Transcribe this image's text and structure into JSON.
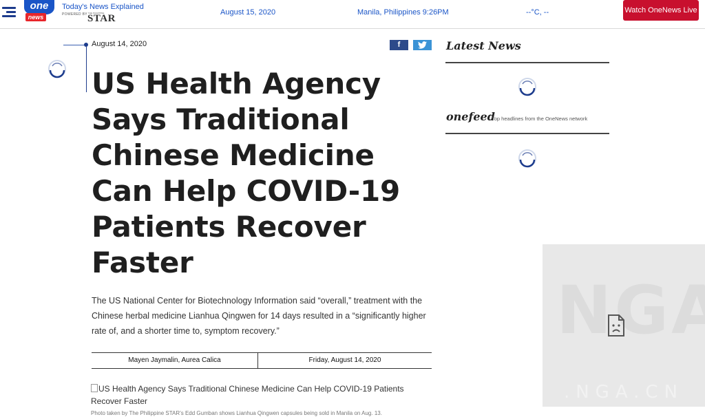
{
  "header": {
    "tagline": "Today's News Explained",
    "logo_one": "one",
    "logo_news": "news",
    "powered_by": "POWERED BY",
    "star_prefix": "THE PHILIPPINE",
    "star": "STAR",
    "date": "August 15, 2020",
    "location_time": "Manila, Philippines 9:26PM",
    "temperature": "--°C, --",
    "watch_button": "Watch OneNews Live"
  },
  "article": {
    "date": "August 14, 2020",
    "share_facebook": "f",
    "headline": "US Health Agency Says Traditional Chinese Medicine Can Help COVID-19 Patients Recover Faster",
    "lede": "The US National Center for Biotechnology Information said “overall,” treatment with the Chinese herbal medicine Lianhua Qingwen for 14 days resulted in a “significantly higher rate of, and a shorter time to, symptom recovery.”",
    "authors": "Mayen Jaymalin, Aurea Calica",
    "byline_date": "Friday, August 14, 2020",
    "image_alt": "US Health Agency Says Traditional Chinese Medicine Can Help COVID-19 Patients Recover Faster",
    "caption": "Photo taken by The Philippine STAR’s Edd Gumban shows Lianhua Qingwen capsules being sold in Manila on Aug. 13."
  },
  "sidebar": {
    "latest_title": "Latest News",
    "onefeed_title": "onefeed",
    "onefeed_subtitle": "Top headlines from the OneNews network"
  },
  "overlay": {
    "watermark": "NGA",
    "url": ".NGA.CN"
  },
  "colors": {
    "brand_blue": "#1a55c7",
    "accent_red": "#c8102e",
    "facebook": "#2d4a8a",
    "twitter": "#3b93d6"
  },
  "icons": [
    "menu-icon",
    "spinner-icon",
    "facebook-icon",
    "twitter-icon",
    "broken-image-icon",
    "sad-document-icon"
  ]
}
